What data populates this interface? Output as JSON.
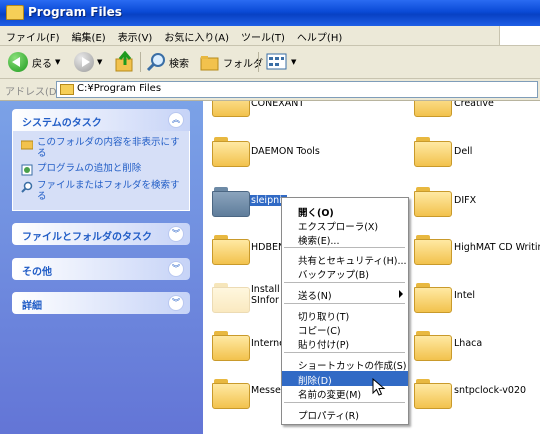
{
  "window": {
    "title": "Program Files"
  },
  "menu": [
    "ファイル(F)",
    "編集(E)",
    "表示(V)",
    "お気に入り(A)",
    "ツール(T)",
    "ヘルプ(H)"
  ],
  "toolbar": {
    "back": "戻る",
    "search": "検索",
    "folders": "フォルダ"
  },
  "address": {
    "label": "アドレス(D)",
    "value": "C:¥Program Files"
  },
  "left": {
    "system_tasks": {
      "title": "システムのタスク",
      "items": [
        "このフォルダの内容を非表示にする",
        "プログラムの追加と削除",
        "ファイルまたはフォルダを検索する"
      ]
    },
    "file_tasks": {
      "title": "ファイルとフォルダのタスク"
    },
    "other": {
      "title": "その他"
    },
    "details": {
      "title": "詳細"
    }
  },
  "folders": {
    "left": [
      "CONEXANT",
      "DAEMON Tools",
      "sleipnir",
      "HDBEN",
      "InstallSInforma",
      "Internet",
      "Messen"
    ],
    "right": [
      "Creative",
      "Dell",
      "DIFX",
      "HighMAT CD Writin",
      "Intel",
      "Lhaca",
      "sntpclock-v020"
    ]
  },
  "context_menu": {
    "items": [
      "開く(O)",
      "エクスプローラ(X)",
      "検索(E)...",
      "共有とセキュリティ(H)...",
      "バックアップ(B)",
      "送る(N)",
      "切り取り(T)",
      "コピー(C)",
      "貼り付け(P)",
      "ショートカットの作成(S)",
      "削除(D)",
      "名前の変更(M)",
      "プロパティ(R)"
    ],
    "highlighted": "削除(D)"
  }
}
